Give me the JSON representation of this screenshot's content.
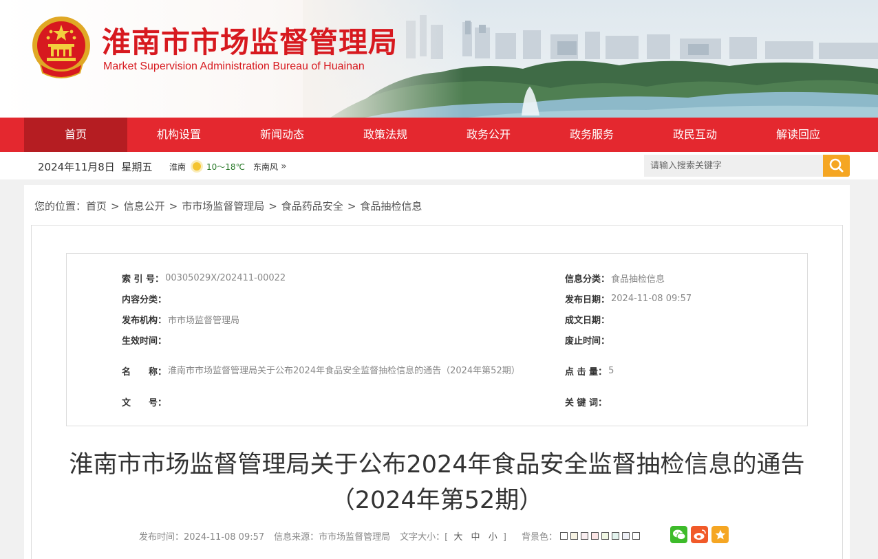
{
  "header": {
    "title": "淮南市市场监督管理局",
    "subtitle": "Market Supervision Administration Bureau of Huainan"
  },
  "nav": {
    "items": [
      {
        "label": "首页",
        "active": true
      },
      {
        "label": "机构设置"
      },
      {
        "label": "新闻动态"
      },
      {
        "label": "政策法规"
      },
      {
        "label": "政务公开"
      },
      {
        "label": "政务服务"
      },
      {
        "label": "政民互动"
      },
      {
        "label": "解读回应"
      }
    ]
  },
  "infobar": {
    "date": "2024年11月8日  星期五",
    "city": "淮南",
    "temp": "10～18℃",
    "wind": "东南风",
    "more": "»",
    "search_placeholder": "请输入搜索关键字"
  },
  "breadcrumb": {
    "prefix": "您的位置：",
    "items": [
      "首页",
      "信息公开",
      "市市场监督管理局",
      "食品药品安全",
      "食品抽检信息"
    ],
    "sep": ">"
  },
  "meta": {
    "index_label": "索 引 号：",
    "index_value": "00305029X/202411-00022",
    "category_label": "信息分类：",
    "category_value": "食品抽检信息",
    "content_cat_label": "内容分类：",
    "content_cat_value": "",
    "pub_date_label": "发布日期：",
    "pub_date_value": "2024-11-08 09:57",
    "org_label": "发布机构：",
    "org_value": "市市场监督管理局",
    "doc_date_label": "成文日期：",
    "doc_date_value": "",
    "effective_label": "生效时间：",
    "effective_value": "",
    "expire_label": "废止时间：",
    "expire_value": "",
    "name_label": "名　　称：",
    "name_value": "淮南市市场监督管理局关于公布2024年食品安全监督抽检信息的通告（2024年第52期）",
    "clicks_label": "点 击 量：",
    "clicks_value": "5",
    "docno_label": "文　　号：",
    "docno_value": "",
    "keywords_label": "关 键 词：",
    "keywords_value": ""
  },
  "article": {
    "title": "淮南市市场监督管理局关于公布2024年食品安全监督抽检信息的通告（2024年第52期）",
    "pub_time": "发布时间：2024-11-08 09:57",
    "source": "信息来源：市市场监督管理局",
    "font_size_label": "文字大小：[",
    "font_size_end": "]",
    "font_sizes": [
      "大",
      "中",
      "小"
    ],
    "bg_label": "背景色：",
    "bg_colors": [
      "#ffffff",
      "#f7f3e3",
      "#f9eef0",
      "#fbe5e5",
      "#f0f7e3",
      "#e3f3ee",
      "#eef0f6",
      "#ffffff"
    ]
  },
  "colors": {
    "brand_red": "#e4282f",
    "nav_active": "#b51d22",
    "search_btn": "#f5a623",
    "wechat": "#3dbb2a",
    "weibo": "#f15a29",
    "favorite": "#f5a623"
  }
}
